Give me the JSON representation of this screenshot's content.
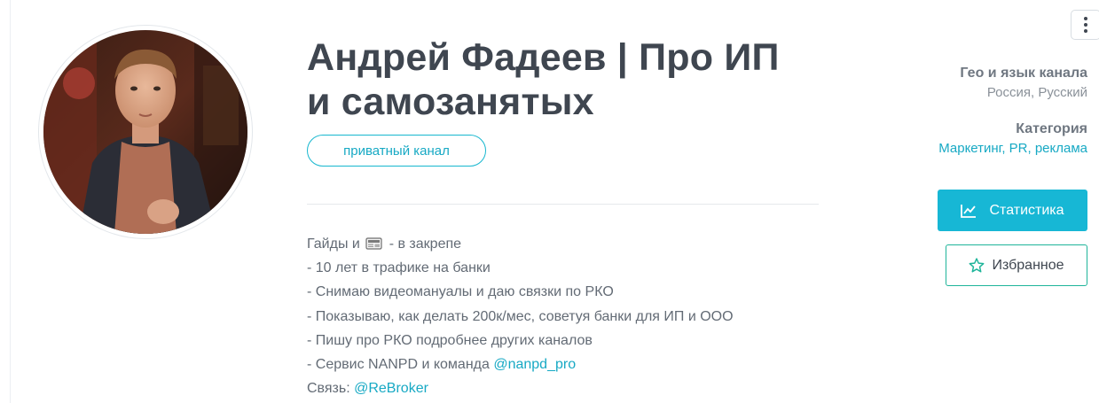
{
  "channel": {
    "title_line1": "Андрей Фадеев | Про ИП",
    "title_line2": "и самозанятых",
    "badge": "приватный канал"
  },
  "description": {
    "line1_before": "Гайды и ",
    "line1_icon": "newspaper-icon",
    "line1_after": " - в закрепе",
    "lines": [
      "- 10 лет в трафике на банки",
      "- Снимаю видеомануалы и даю связки по РКО",
      "- Показываю, как делать 200к/мес, советуя банки для ИП и ООО",
      "- Пишу про РКО подробнее других каналов"
    ],
    "service_prefix": "- Сервис NANPD и команда ",
    "service_link": "@nanpd_pro",
    "contact_prefix": "Связь: ",
    "contact_link": "@ReBroker"
  },
  "meta": {
    "geo_label": "Гео и язык канала",
    "geo_value": "Россия, Русский",
    "category_label": "Категория",
    "category_value": "Маркетинг, PR, реклама"
  },
  "actions": {
    "stats_label": "Статистика",
    "stats_icon": "chart-line-icon",
    "favorite_label": "Избранное",
    "favorite_icon": "star-icon",
    "menu_icon": "more-vertical-icon"
  },
  "colors": {
    "accent": "#17b7d5",
    "link": "#17a9c4",
    "favorite_border": "#1fb59a",
    "title": "#3f4650"
  }
}
